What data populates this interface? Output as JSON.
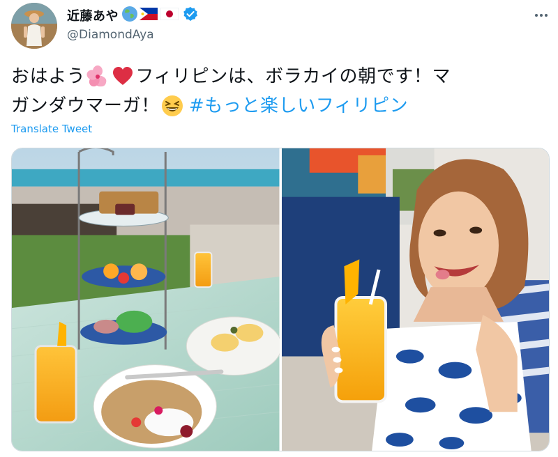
{
  "user": {
    "display_name": "近藤あや",
    "handle": "@DiamondAya",
    "name_emojis": [
      "globe-icon",
      "philippines-flag-icon",
      "japan-flag-icon"
    ],
    "verified": true
  },
  "tweet": {
    "line1_a": "おはよう",
    "line1_b": "フィリピンは、ボラカイの朝です！マ",
    "line2_a": "ガンダウマーガ！",
    "hashtag": "#もっと楽しいフィリピン",
    "emojis": [
      "hibiscus-icon",
      "red-heart-icon",
      "grinning-squinting-face-icon"
    ]
  },
  "translate_label": "Translate Tweet",
  "media": {
    "count": 2,
    "items": [
      "breakfast-photo",
      "woman-with-mango-juice-photo"
    ]
  },
  "colors": {
    "link": "#1d9bf0",
    "secondary_text": "#536471",
    "verified": "#1d9bf0"
  }
}
